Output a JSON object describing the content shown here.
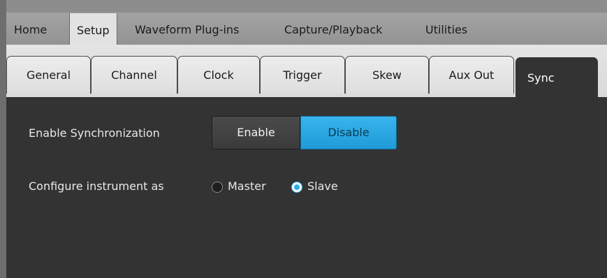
{
  "menu": {
    "items": [
      {
        "label": "Home"
      },
      {
        "label": "Setup",
        "active": true
      },
      {
        "label": "Waveform Plug-ins"
      },
      {
        "label": "Capture/Playback"
      },
      {
        "label": "Utilities"
      }
    ]
  },
  "tabs": {
    "items": [
      {
        "label": "General"
      },
      {
        "label": "Channel"
      },
      {
        "label": "Clock"
      },
      {
        "label": "Trigger"
      },
      {
        "label": "Skew"
      },
      {
        "label": "Aux Out"
      },
      {
        "label": "Sync",
        "active": true
      }
    ]
  },
  "sync": {
    "enable_label": "Enable Synchronization",
    "enable_button": "Enable",
    "disable_button": "Disable",
    "selected": "Disable",
    "configure_label": "Configure instrument as",
    "master_label": "Master",
    "slave_label": "Slave",
    "role": "Slave"
  },
  "colors": {
    "accent": "#1e9bd8",
    "panel_background": "#333333"
  }
}
